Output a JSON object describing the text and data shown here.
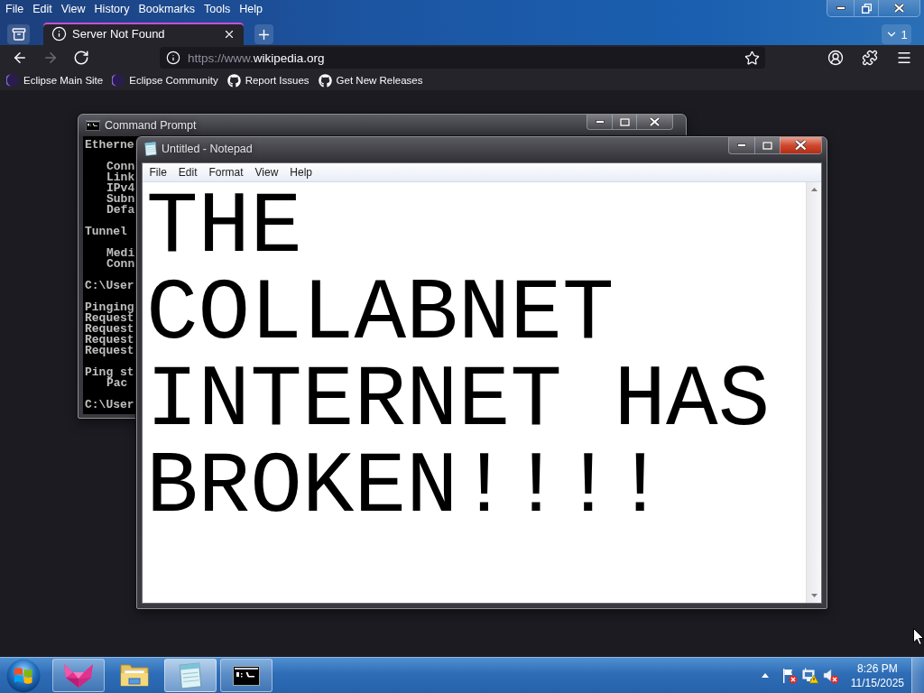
{
  "browser": {
    "menu_bar": [
      "File",
      "Edit",
      "View",
      "History",
      "Bookmarks",
      "Tools",
      "Help"
    ],
    "tabs": [
      {
        "title": "Server Not Found",
        "selected": true
      }
    ],
    "tab_count": "1",
    "nav_buttons": [
      {
        "kind": "back",
        "disabled": false
      },
      {
        "kind": "forward",
        "disabled": true
      },
      {
        "kind": "reload",
        "disabled": false
      }
    ],
    "address": {
      "dimmed_part": "https://www.",
      "host": "wikipedia.org"
    },
    "bookmarks": [
      {
        "label": "Eclipse Main Site",
        "kind": "crescent"
      },
      {
        "label": "Eclipse Community",
        "kind": "crescent"
      },
      {
        "label": "Report Issues",
        "kind": "cat"
      },
      {
        "label": "Get New Releases",
        "kind": "cat"
      }
    ]
  },
  "desktop": {
    "command_prompt": {
      "title": "Command Prompt",
      "output": [
        {
          "lines": [
            "Etherne"
          ]
        },
        {
          "children": [
            {
              "lines": [
                "Conn",
                "Link",
                "IPv4",
                "Subn",
                "Defa"
              ]
            }
          ]
        },
        {
          "lines": [
            "Tunnel"
          ]
        },
        {
          "children": [
            {
              "lines": [
                "Medi",
                "Conn"
              ]
            }
          ]
        },
        {
          "lines": [
            "C:\\User"
          ]
        },
        {
          "lines": [
            "Pinging",
            "Request",
            "Request",
            "Request",
            "Request"
          ]
        },
        {
          "lines": [
            "Ping st"
          ],
          "children": [
            {
              "lines": [
                "Pac"
              ]
            }
          ]
        },
        {
          "lines": [
            "C:\\User"
          ]
        }
      ]
    },
    "notepad": {
      "title": "Untitled - Notepad",
      "menu": [
        "File",
        "Edit",
        "Format",
        "View",
        "Help"
      ],
      "text": "THE COLLABNET INTERNET HAS BROKEN!!!!"
    }
  },
  "taskbar": {
    "apps": [
      {
        "kind": "browser",
        "running": true,
        "selected": false
      },
      {
        "kind": "folder",
        "running": false,
        "selected": false
      },
      {
        "kind": "notepad",
        "running": true,
        "selected": true
      },
      {
        "kind": "terminal",
        "running": true,
        "selected": false
      }
    ],
    "tray": [
      {
        "kind": "flag",
        "error": true,
        "warning": false
      },
      {
        "kind": "network",
        "error": false,
        "warning": true
      },
      {
        "kind": "speaker",
        "error": true,
        "warning": false
      }
    ],
    "clock": {
      "time": "8:26 PM",
      "date": "11/15/2025"
    }
  }
}
